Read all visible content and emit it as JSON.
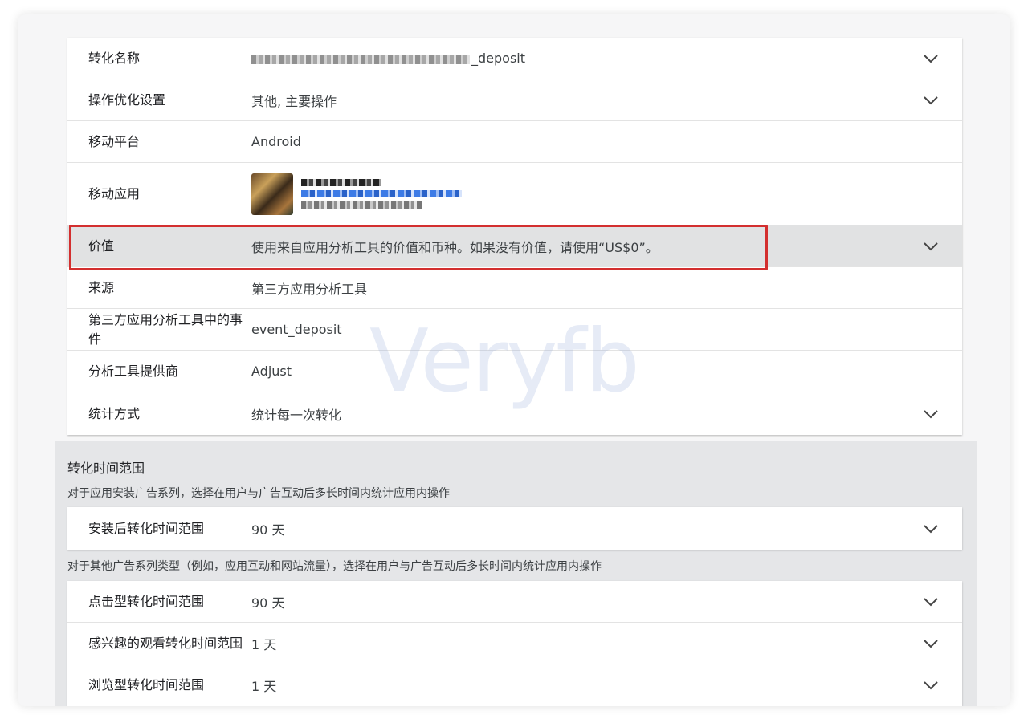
{
  "details": [
    {
      "label": "转化名称",
      "value": "_deposit",
      "chevron": true,
      "obscured_prefix": true
    },
    {
      "label": "操作优化设置",
      "value": "其他, 主要操作",
      "chevron": true
    },
    {
      "label": "移动平台",
      "value": "Android",
      "chevron": false
    },
    {
      "label": "移动应用",
      "value": "",
      "chevron": false,
      "app": true
    },
    {
      "label": "价值",
      "value": "使用来自应用分析工具的价值和币种。如果没有价值，请使用“US$0”。",
      "chevron": true,
      "selected": true
    },
    {
      "label": "来源",
      "value": "第三方应用分析工具",
      "chevron": false
    },
    {
      "label": "第三方应用分析工具中的事件",
      "value": "event_deposit",
      "chevron": false
    },
    {
      "label": "分析工具提供商",
      "value": "Adjust",
      "chevron": false
    },
    {
      "label": "统计方式",
      "value": "统计每一次转化",
      "chevron": true
    }
  ],
  "conversion_window": {
    "title": "转化时间范围",
    "app_install_desc": "对于应用安装广告系列，选择在用户与广告互动后多长时间内统计应用内操作",
    "install_rows": [
      {
        "label": "安装后转化时间范围",
        "value": "90 天"
      }
    ],
    "other_desc": "对于其他广告系列类型（例如，应用互动和网站流量），选择在用户与广告互动后多长时间内统计应用内操作",
    "other_rows": [
      {
        "label": "点击型转化时间范围",
        "value": "90 天"
      },
      {
        "label": "感兴趣的观看转化时间范围",
        "value": "1 天"
      },
      {
        "label": "浏览型转化时间范围",
        "value": "1 天"
      }
    ]
  },
  "watermark": "Veryfb",
  "colors": {
    "highlight": "#d32f2f",
    "selected_row": "#e1e2e3",
    "panel_bg": "#e5e6e8"
  }
}
